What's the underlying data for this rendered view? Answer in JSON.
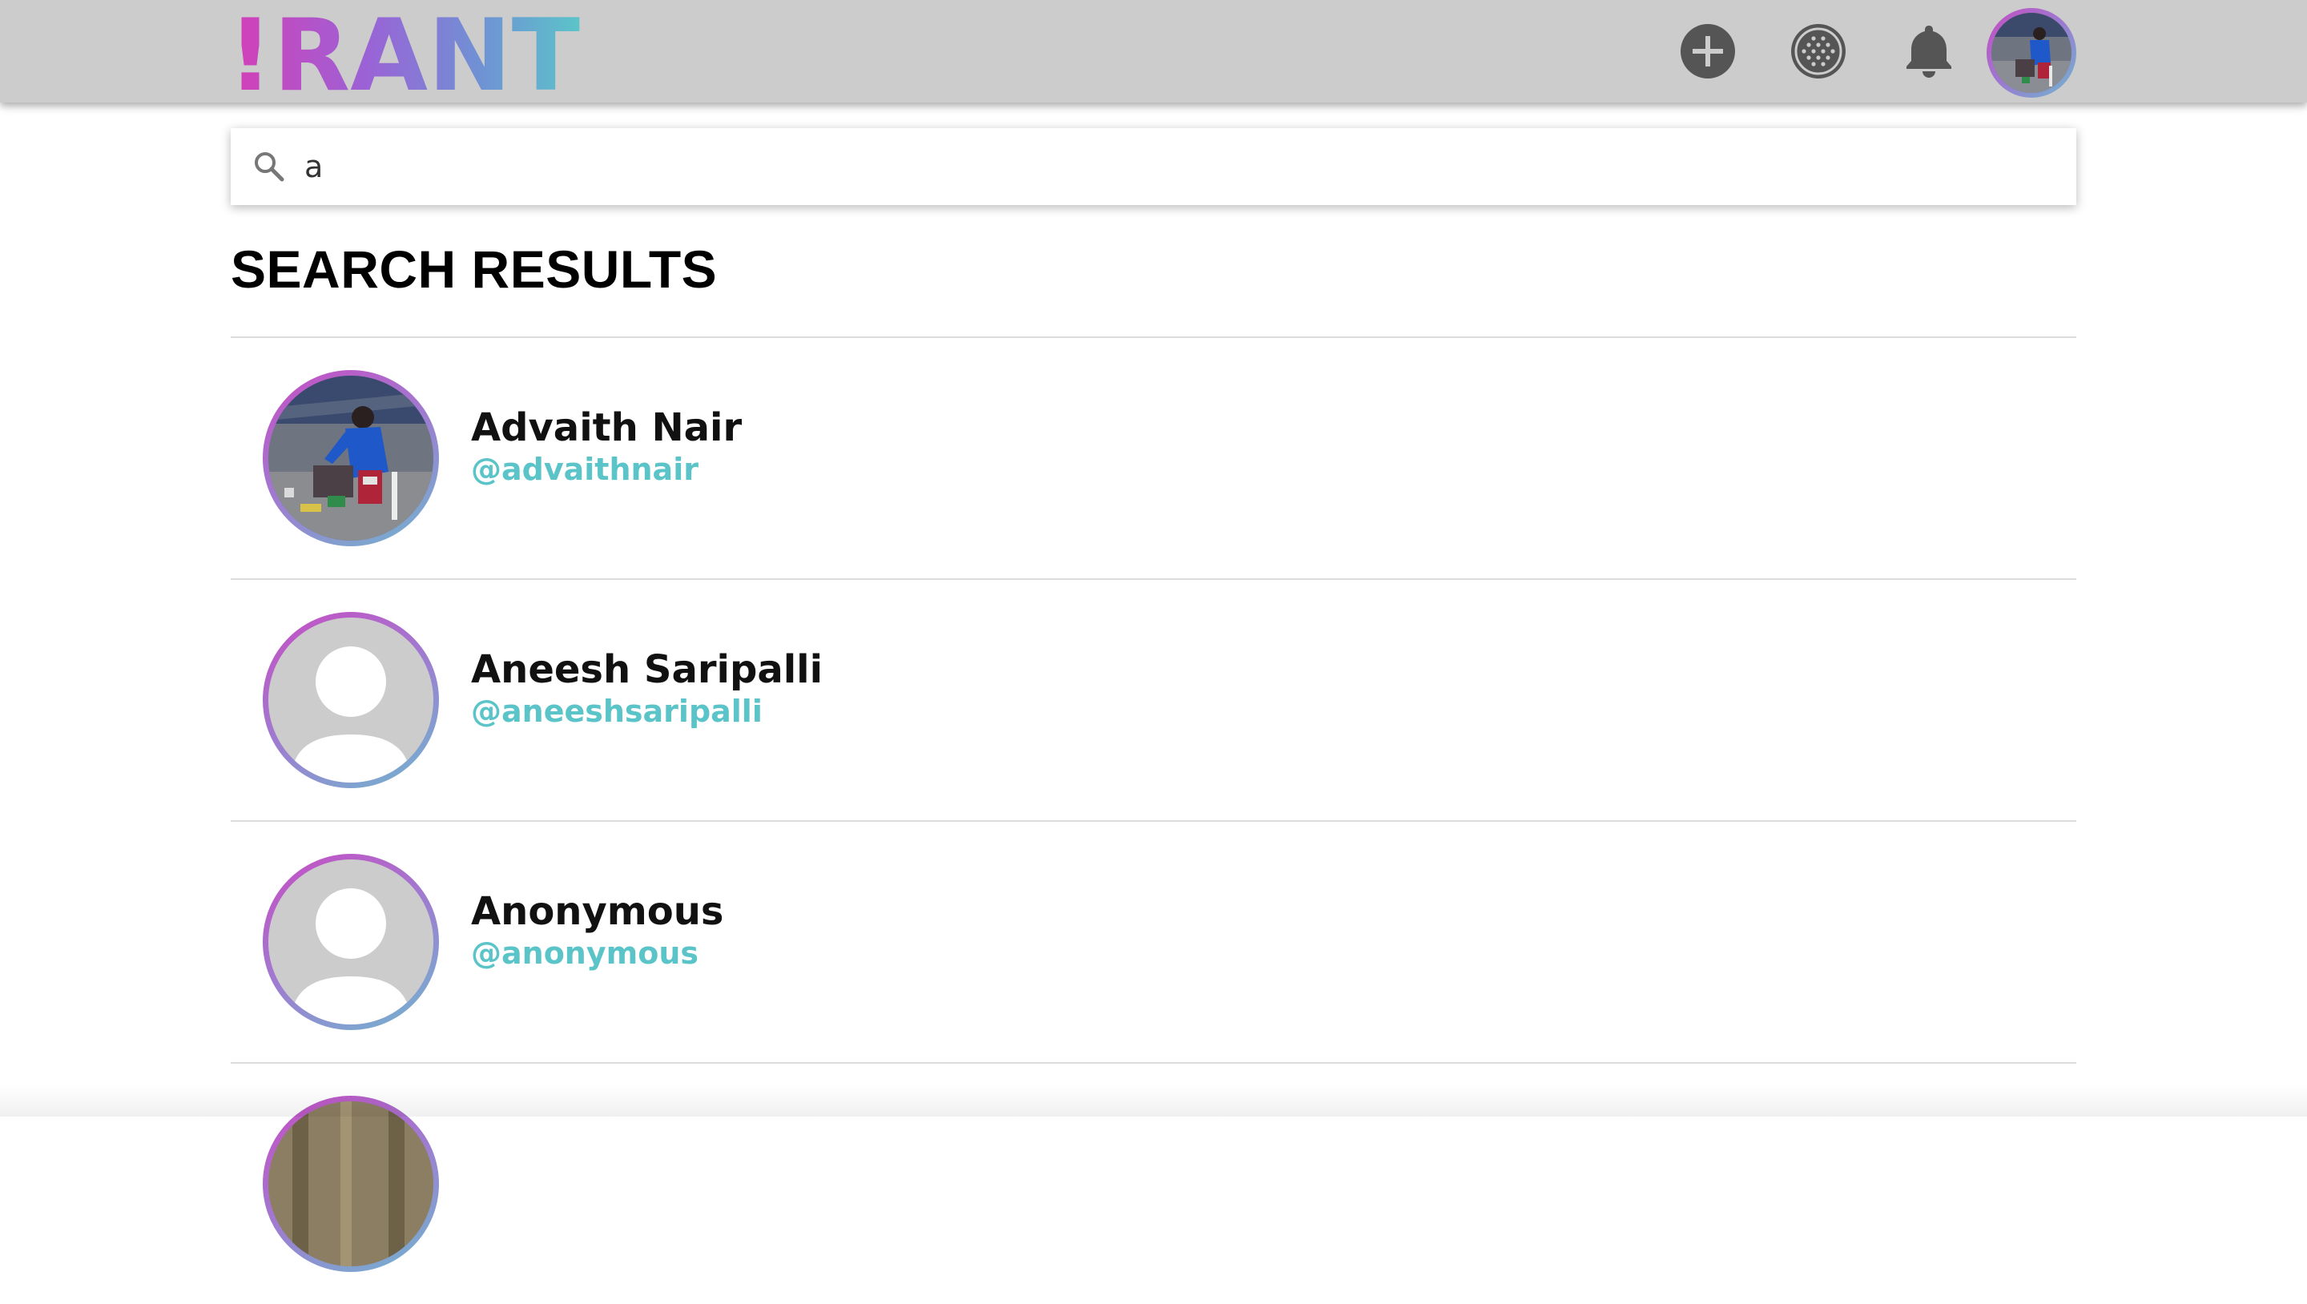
{
  "app": {
    "logo_text": "!RANT",
    "colors": {
      "brand_pink": "#d63db6",
      "brand_purple": "#9a63d6",
      "brand_blue": "#6f92d4",
      "brand_teal": "#5bc4c9",
      "topbar_bg": "#cccccc",
      "icon_dark": "#555555"
    }
  },
  "nav": {
    "icons": [
      "plus-circle-icon",
      "dot-grid-icon",
      "bell-icon",
      "user-avatar"
    ]
  },
  "search": {
    "value": "a",
    "placeholder": ""
  },
  "results": {
    "title": "SEARCH RESULTS",
    "items": [
      {
        "name": "Advaith Nair",
        "handle": "@advaithnair",
        "avatar": "photo"
      },
      {
        "name": "Aneesh Saripalli",
        "handle": "@aneeshsaripalli",
        "avatar": "default"
      },
      {
        "name": "Anonymous",
        "handle": "@anonymous",
        "avatar": "default"
      }
    ]
  }
}
